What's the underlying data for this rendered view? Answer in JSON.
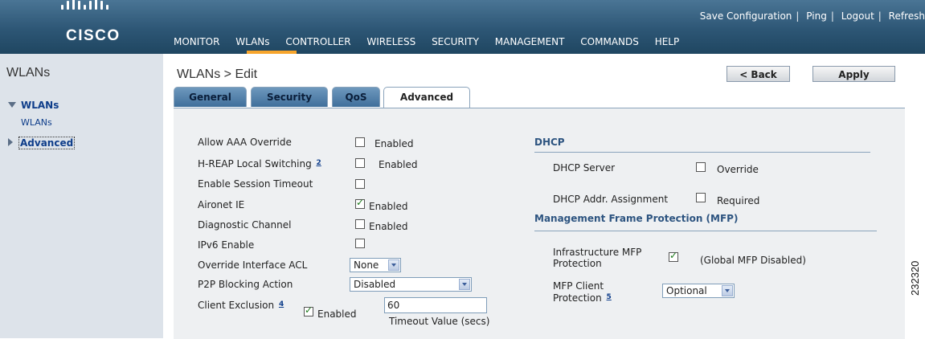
{
  "brand": {
    "logo_text": "CISCO"
  },
  "utility": {
    "save": "Save Configuration",
    "ping": "Ping",
    "logout": "Logout",
    "refresh": "Refresh"
  },
  "nav": [
    "MONITOR",
    "WLANs",
    "CONTROLLER",
    "WIRELESS",
    "SECURITY",
    "MANAGEMENT",
    "COMMANDS",
    "HELP"
  ],
  "nav_active": "WLANs",
  "sidebar": {
    "title": "WLANs",
    "group": "WLANs",
    "sub_item": "WLANs",
    "advanced": "Advanced"
  },
  "page": {
    "title": "WLANs > Edit",
    "back_label": "< Back",
    "apply_label": "Apply"
  },
  "tabs": [
    "General",
    "Security",
    "QoS",
    "Advanced"
  ],
  "active_tab": "Advanced",
  "left_fields": {
    "aaa_override": {
      "label": "Allow AAA Override",
      "checked": false,
      "text": "Enabled"
    },
    "hreap": {
      "label": "H-REAP Local Switching",
      "help": "2",
      "checked": false,
      "text": "Enabled"
    },
    "session_timeout": {
      "label": "Enable Session Timeout",
      "checked": false
    },
    "aironet_ie": {
      "label": "Aironet IE",
      "checked": true,
      "text": "Enabled"
    },
    "diag_channel": {
      "label": "Diagnostic Channel",
      "checked": false,
      "text": "Enabled"
    },
    "ipv6": {
      "label": "IPv6 Enable",
      "checked": false
    },
    "override_acl": {
      "label": "Override Interface ACL",
      "value": "None"
    },
    "p2p": {
      "label": "P2P Blocking Action",
      "value": "Disabled"
    },
    "client_exclusion": {
      "label": "Client Exclusion",
      "help": "4",
      "checked": true,
      "text": "Enabled",
      "timeout_value": "60",
      "timeout_label": "Timeout Value (secs)"
    }
  },
  "dhcp": {
    "title": "DHCP",
    "server_label": "DHCP Server",
    "server_text": "Override",
    "server_checked": false,
    "assign_label": "DHCP Addr. Assignment",
    "assign_text": "Required",
    "assign_checked": false
  },
  "mfp": {
    "title": "Management Frame Protection (MFP)",
    "infra_label_1": "Infrastructure MFP",
    "infra_label_2": "Protection",
    "infra_checked": true,
    "infra_note": "(Global MFP Disabled)",
    "client_label_1": "MFP Client",
    "client_label_2": "Protection",
    "client_help": "5",
    "client_value": "Optional"
  },
  "figure_number": "232320"
}
